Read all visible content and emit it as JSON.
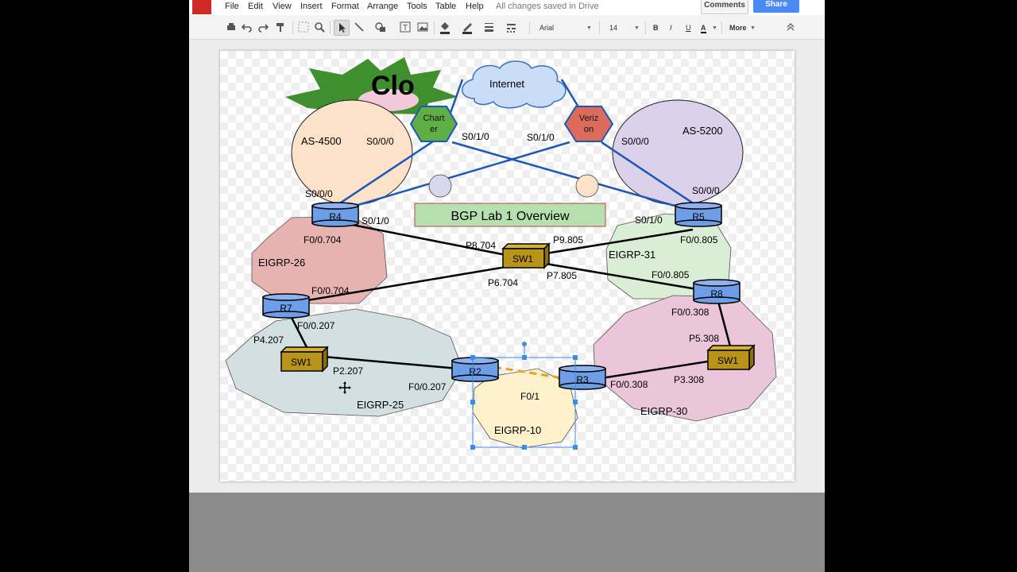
{
  "menu": {
    "items": [
      "File",
      "Edit",
      "View",
      "Insert",
      "Format",
      "Arrange",
      "Tools",
      "Table",
      "Help"
    ],
    "save_status": "All changes saved in Drive",
    "comments_label": "Comments",
    "share_label": "Share"
  },
  "toolbar": {
    "font": "Arial",
    "size": "14",
    "bold": "B",
    "italic": "I",
    "underline": "U",
    "text_color": "A",
    "more": "More"
  },
  "colors": {
    "router": "#6f9ee8",
    "switch": "#b8941a",
    "charter": "#5fae45",
    "verizon": "#dd6b5b",
    "cloud": "#c9dcf8",
    "link_blue": "#1d57b5",
    "link_black": "#000000",
    "dashed": "#e8a21c"
  },
  "icons": [
    "print-icon",
    "undo-icon",
    "redo-icon",
    "paint-format-icon",
    "select-icon",
    "zoom-icon",
    "pointer-icon",
    "line-icon",
    "shape-icon",
    "textbox-icon",
    "image-icon",
    "fill-icon",
    "line-color-icon",
    "line-weight-icon",
    "line-dash-icon",
    "collapse-icon",
    "move-cursor-icon"
  ],
  "diagram": {
    "title_fragment": "Clo",
    "internet": "Internet",
    "charter": [
      "Chart",
      "er"
    ],
    "verizon": [
      "Veriz",
      "on"
    ],
    "as4500": "AS-4500",
    "as5200": "AS-5200",
    "banner": "BGP Lab 1 Overview",
    "eigrp26": "EIGRP-26",
    "eigrp31": "EIGRP-31",
    "eigrp25": "EIGRP-25",
    "eigrp30": "EIGRP-30",
    "eigrp10": "EIGRP-10",
    "routers": {
      "r4": "R4",
      "r5": "R5",
      "r7": "R7",
      "r8": "R8",
      "r2": "R2",
      "r3": "R3"
    },
    "switches": {
      "sw_center": "SW1",
      "sw_left": "SW1",
      "sw_right": "SW1"
    },
    "labels": {
      "s000_charter": "S0/0/0",
      "s010_charter": "S0/1/0",
      "s010_verizon": "S0/1/0",
      "s000_verizon": "S0/0/0",
      "s000_r4": "S0/0/0",
      "s010_r4": "S0/1/0",
      "s000_r5": "S0/0/0",
      "s010_r5": "S0/1/0",
      "f0704_r4": "F0/0.704",
      "f0805_r5": "F0/0.805",
      "p8704": "P8.704",
      "p9805": "P9.805",
      "p6704": "P6.704",
      "p7805": "P7.805",
      "f0704_r7": "F0/0.704",
      "f0805_r8": "F0/0.805",
      "f0207_r7": "F0/0.207",
      "f0308_r8": "F0/0.308",
      "p4207": "P4.207",
      "p2207": "P2.207",
      "f0207_r2": "F0/0.207",
      "p5308": "P5.308",
      "p3308": "P3.308",
      "f0308_r3": "F0/0.308",
      "f01": "F0/1"
    }
  }
}
